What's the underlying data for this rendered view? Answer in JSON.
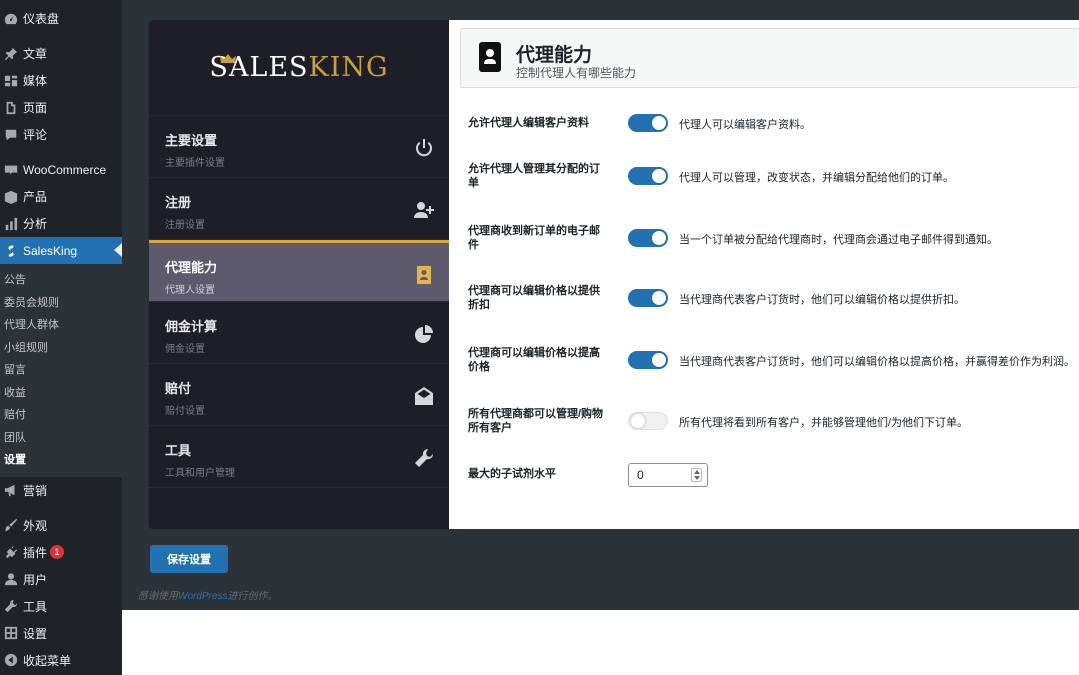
{
  "wp_menu": {
    "items_top": [
      {
        "label": "仪表盘",
        "icon": "dashboard-icon"
      },
      {
        "label": "文章",
        "icon": "pin-icon"
      },
      {
        "label": "媒体",
        "icon": "media-icon"
      },
      {
        "label": "页面",
        "icon": "page-icon"
      },
      {
        "label": "评论",
        "icon": "comment-icon"
      },
      {
        "label": "WooCommerce",
        "icon": "woocommerce-icon"
      },
      {
        "label": "产品",
        "icon": "product-icon"
      },
      {
        "label": "分析",
        "icon": "analytics-icon"
      },
      {
        "label": "SalesKing",
        "icon": "salesking-icon"
      }
    ],
    "submenu": [
      "公告",
      "委员会规则",
      "代理人群体",
      "小组规则",
      "留言",
      "收益",
      "赔付",
      "团队",
      "设置"
    ],
    "items_bottom": [
      {
        "label": "营销",
        "icon": "megaphone-icon"
      },
      {
        "label": "外观",
        "icon": "brush-icon"
      },
      {
        "label": "插件",
        "icon": "plugin-icon",
        "badge": "1"
      },
      {
        "label": "用户",
        "icon": "user-icon"
      },
      {
        "label": "工具",
        "icon": "wrench-icon"
      },
      {
        "label": "设置",
        "icon": "settings-icon"
      },
      {
        "label": "收起菜单",
        "icon": "collapse-icon"
      }
    ]
  },
  "plugin": {
    "logo": {
      "sales": "SALES",
      "king": "KING"
    },
    "nav": [
      {
        "title": "主要设置",
        "subtitle": "主要插件设置",
        "icon": "power-icon"
      },
      {
        "title": "注册",
        "subtitle": "注册设置",
        "icon": "user-plus-icon"
      },
      {
        "title": "代理能力",
        "subtitle": "代理人设置",
        "icon": "id-badge-icon"
      },
      {
        "title": "佣金计算",
        "subtitle": "佣金设置",
        "icon": "pie-chart-icon"
      },
      {
        "title": "赔付",
        "subtitle": "赔付设置",
        "icon": "envelope-open-icon"
      },
      {
        "title": "工具",
        "subtitle": "工具和用户管理",
        "icon": "wrench-icon"
      }
    ],
    "header": {
      "title": "代理能力",
      "subtitle": "控制代理人有哪些能力"
    },
    "settings": [
      {
        "label": "允许代理人编辑客户资料",
        "on": true,
        "desc": "代理人可以编辑客户资料。"
      },
      {
        "label": "允许代理人管理其分配的订单",
        "on": true,
        "desc": "代理人可以管理，改变状态，并编辑分配给他们的订单。"
      },
      {
        "label": "代理商收到新订单的电子邮件",
        "on": true,
        "desc": "当一个订单被分配给代理商时，代理商会通过电子邮件得到通知。"
      },
      {
        "label": "代理商可以编辑价格以提供折扣",
        "on": true,
        "desc": "当代理商代表客户订货时，他们可以编辑价格以提供折扣。"
      },
      {
        "label": "代理商可以编辑价格以提高价格",
        "on": true,
        "desc": "当代理商代表客户订货时，他们可以编辑价格以提高价格，并赢得差价作为利润。"
      },
      {
        "label": "所有代理商都可以管理/购物所有客户",
        "on": false,
        "desc": "所有代理将看到所有客户，并能够管理他们/为他们下订单。"
      }
    ],
    "max_level": {
      "label": "最大的子试剂水平",
      "value": "0"
    },
    "save_label": "保存设置"
  },
  "footer": {
    "prefix": "感谢使用",
    "link": "WordPress",
    "suffix": "进行创作。"
  },
  "colors": {
    "accent": "#2271b1",
    "gold": "#c9a13c",
    "sidebar": "#1d2327"
  }
}
